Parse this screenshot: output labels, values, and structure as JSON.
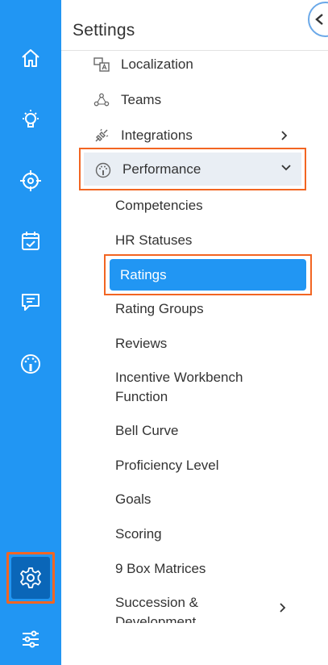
{
  "nav": {
    "rail": [
      {
        "name": "home-icon"
      },
      {
        "name": "lightbulb-icon"
      },
      {
        "name": "target-icon"
      },
      {
        "name": "calendar-check-icon"
      },
      {
        "name": "chat-icon"
      },
      {
        "name": "speedometer-icon"
      },
      {
        "name": "gear-icon",
        "selected": true
      },
      {
        "name": "sliders-icon"
      }
    ]
  },
  "panel": {
    "title": "Settings",
    "items": [
      {
        "label": "Localization",
        "icon": "localization-icon"
      },
      {
        "label": "Teams",
        "icon": "teams-icon"
      },
      {
        "label": "Integrations",
        "icon": "plug-icon",
        "chevron": "right"
      },
      {
        "label": "Performance",
        "icon": "gauge-icon",
        "chevron": "down",
        "expanded": true
      }
    ],
    "performance_children": [
      "Competencies",
      "HR Statuses",
      "Ratings",
      "Rating Groups",
      "Reviews",
      "Incentive Workbench Function",
      "Bell Curve",
      "Proficiency Level",
      "Goals",
      "Scoring",
      "9 Box Matrices",
      "Succession & Development"
    ],
    "selected_child": "Ratings"
  },
  "colors": {
    "rail": "#2196f3",
    "accent": "#2196f3",
    "highlight_border": "#f26522"
  }
}
